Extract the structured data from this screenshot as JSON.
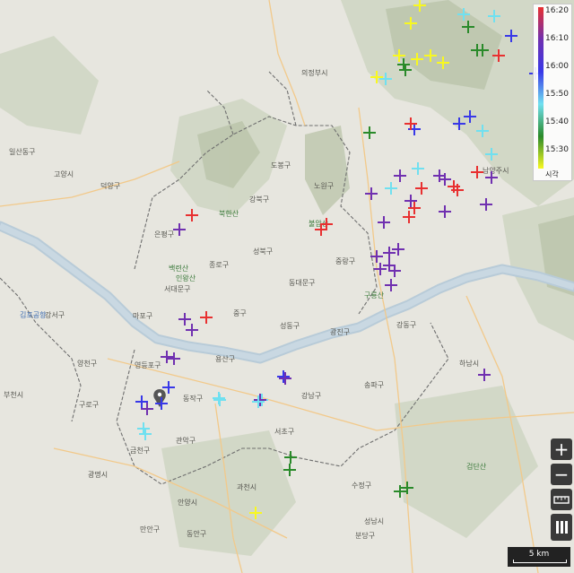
{
  "legend": {
    "ticks": [
      "16:20",
      "16:10",
      "16:00",
      "15:50",
      "15:40",
      "15:30"
    ],
    "caption": "시각",
    "colors": [
      "#e83030",
      "#7030b0",
      "#3838e8",
      "#70e0f0",
      "#2a8a2a",
      "#f8f820"
    ]
  },
  "controls": {
    "zoom_in": "+",
    "zoom_out": "−"
  },
  "scale": {
    "label": "5 km"
  },
  "places": [
    {
      "name": "일산동구"
    },
    {
      "name": "고양시"
    },
    {
      "name": "덕양구"
    },
    {
      "name": "의정부시"
    },
    {
      "name": "도봉구"
    },
    {
      "name": "노원구"
    },
    {
      "name": "강북구"
    },
    {
      "name": "은평구"
    },
    {
      "name": "성북구"
    },
    {
      "name": "중랑구"
    },
    {
      "name": "동대문구"
    },
    {
      "name": "종로구"
    },
    {
      "name": "서대문구"
    },
    {
      "name": "마포구"
    },
    {
      "name": "중구"
    },
    {
      "name": "용산구"
    },
    {
      "name": "성동구"
    },
    {
      "name": "광진구"
    },
    {
      "name": "강동구"
    },
    {
      "name": "송파구"
    },
    {
      "name": "강남구"
    },
    {
      "name": "서초구"
    },
    {
      "name": "동작구"
    },
    {
      "name": "영등포구"
    },
    {
      "name": "양천구"
    },
    {
      "name": "강서구"
    },
    {
      "name": "구로구"
    },
    {
      "name": "금천구"
    },
    {
      "name": "관악구"
    },
    {
      "name": "과천시"
    },
    {
      "name": "광명시"
    },
    {
      "name": "부천시"
    },
    {
      "name": "하남시"
    },
    {
      "name": "남양주시"
    },
    {
      "name": "수정구"
    },
    {
      "name": "성남시"
    },
    {
      "name": "분당구"
    },
    {
      "name": "안양시"
    },
    {
      "name": "만안구"
    },
    {
      "name": "동안구"
    },
    {
      "name": "김포공항"
    },
    {
      "name": "북한산"
    },
    {
      "name": "백련산"
    },
    {
      "name": "인왕산"
    },
    {
      "name": "불암산"
    },
    {
      "name": "검단산"
    },
    {
      "name": "구룡산"
    }
  ],
  "strikes": [
    {
      "c": 5
    },
    {
      "c": 5
    },
    {
      "c": 5
    },
    {
      "c": 5
    },
    {
      "c": 5
    },
    {
      "c": 5
    },
    {
      "c": 5
    },
    {
      "c": 5
    },
    {
      "c": 3
    },
    {
      "c": 3
    },
    {
      "c": 3
    },
    {
      "c": 3
    },
    {
      "c": 3
    },
    {
      "c": 3
    },
    {
      "c": 3
    },
    {
      "c": 3
    },
    {
      "c": 4
    },
    {
      "c": 4
    },
    {
      "c": 4
    },
    {
      "c": 4
    },
    {
      "c": 4
    },
    {
      "c": 4
    },
    {
      "c": 4
    },
    {
      "c": 4
    },
    {
      "c": 4
    },
    {
      "c": 4
    },
    {
      "c": 2
    },
    {
      "c": 2
    },
    {
      "c": 2
    },
    {
      "c": 2
    },
    {
      "c": 2
    },
    {
      "c": 2
    },
    {
      "c": 2
    },
    {
      "c": 2
    },
    {
      "c": 2
    },
    {
      "c": 0
    },
    {
      "c": 0
    },
    {
      "c": 0
    },
    {
      "c": 0
    },
    {
      "c": 0
    },
    {
      "c": 0
    },
    {
      "c": 0
    },
    {
      "c": 0
    },
    {
      "c": 0
    },
    {
      "c": 0
    },
    {
      "c": 0
    },
    {
      "c": 0
    },
    {
      "c": 1
    },
    {
      "c": 1
    },
    {
      "c": 1
    },
    {
      "c": 1
    },
    {
      "c": 1
    },
    {
      "c": 1
    },
    {
      "c": 1
    },
    {
      "c": 1
    },
    {
      "c": 1
    },
    {
      "c": 1
    },
    {
      "c": 1
    },
    {
      "c": 1
    },
    {
      "c": 1
    },
    {
      "c": 1
    },
    {
      "c": 1
    },
    {
      "c": 1
    },
    {
      "c": 1
    },
    {
      "c": 1
    },
    {
      "c": 1
    },
    {
      "c": 1
    },
    {
      "c": 1
    },
    {
      "c": 1
    },
    {
      "c": 1
    },
    {
      "c": 1
    },
    {
      "c": 1
    },
    {
      "c": 3
    },
    {
      "c": 3
    },
    {
      "c": 3
    },
    {
      "c": 3
    },
    {
      "c": 3
    }
  ]
}
